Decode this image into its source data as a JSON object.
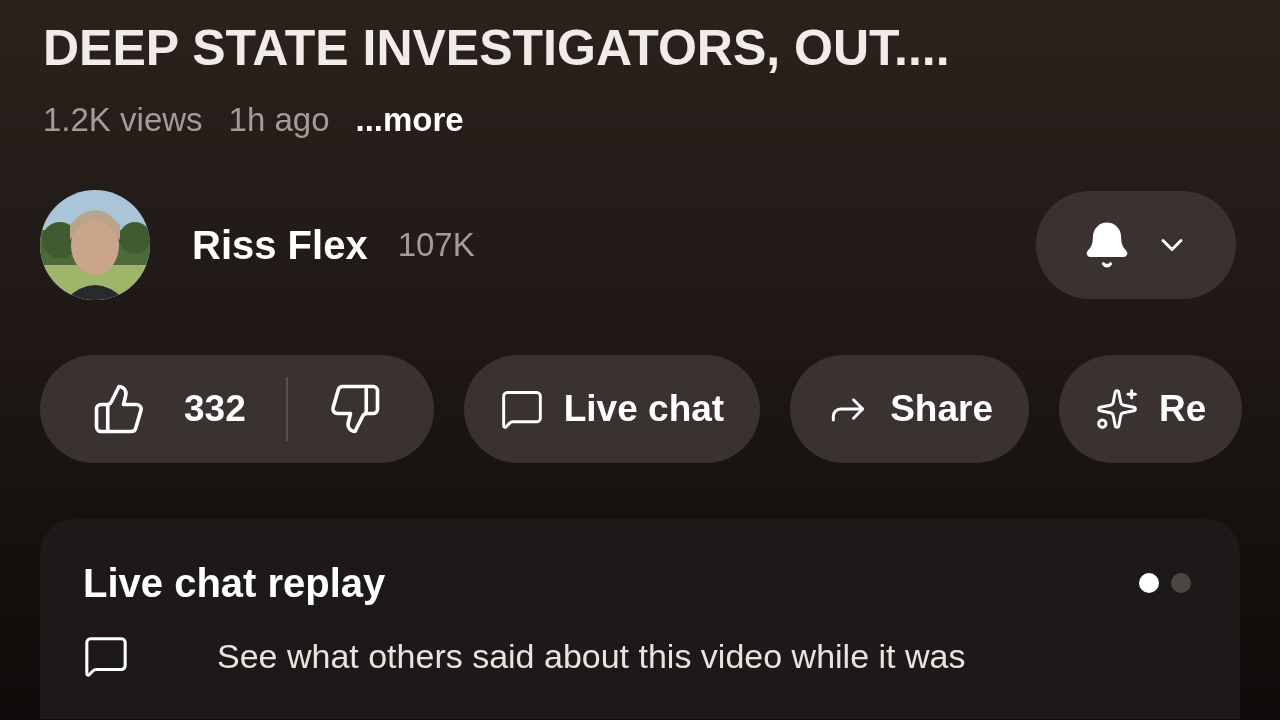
{
  "video": {
    "title": "DEEP STATE INVESTIGATORS, OUT....",
    "views": "1.2K views",
    "age": "1h ago",
    "more": "...more"
  },
  "channel": {
    "name": "Riss Flex",
    "subscribers": "107K"
  },
  "actions": [
    {
      "kind": "like",
      "count": "332"
    },
    {
      "kind": "chat",
      "label": "Live chat"
    },
    {
      "kind": "share",
      "label": "Share"
    },
    {
      "kind": "remix",
      "label": "Re"
    }
  ],
  "live_chat_replay": {
    "title": "Live chat replay",
    "pages": [
      {
        "selected": true
      },
      {
        "selected": false
      }
    ],
    "description": "See what others said about this video while it was"
  }
}
